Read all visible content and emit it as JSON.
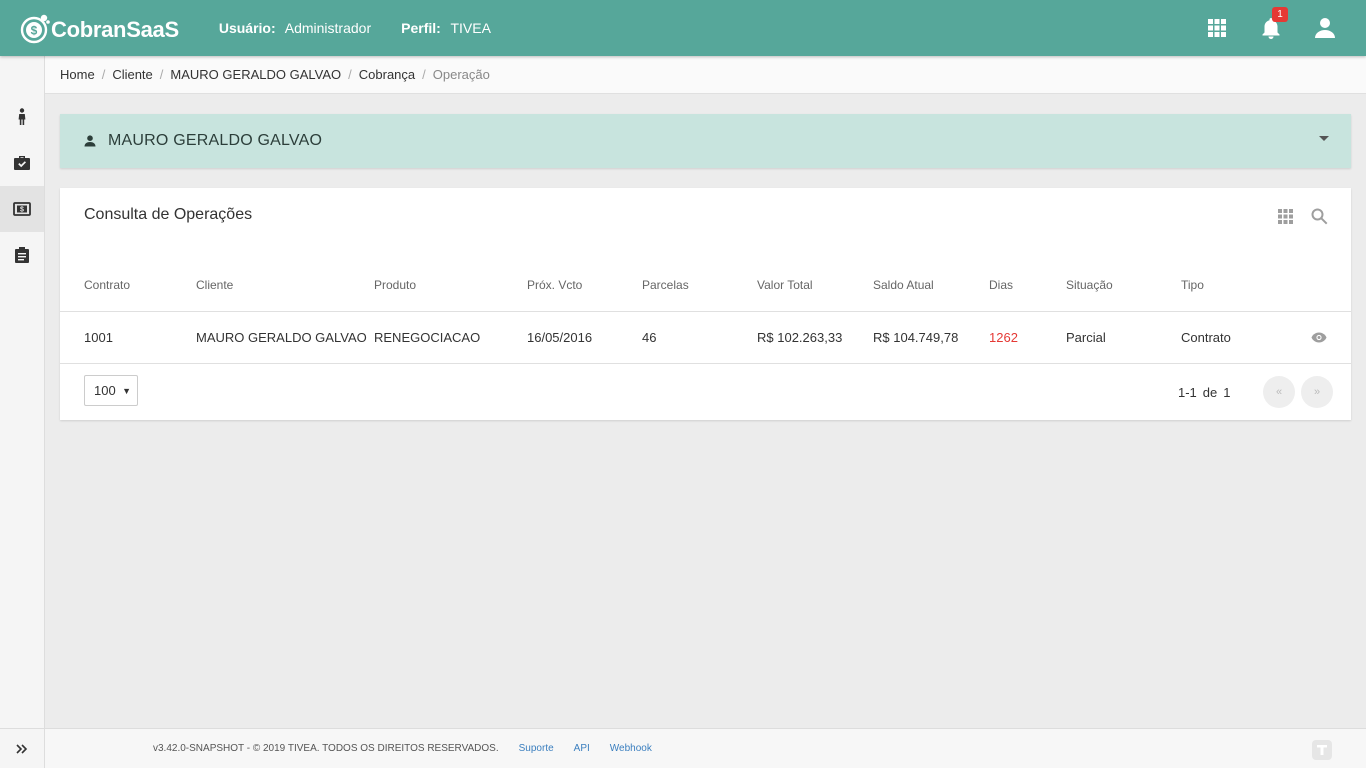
{
  "app": {
    "name": "CobranSaaS",
    "brand_color": "#56a79a"
  },
  "header": {
    "user_label": "Usuário:",
    "user_value": "Administrador",
    "profile_label": "Perfil:",
    "profile_value": "TIVEA",
    "notifications_count": "1",
    "icons": [
      "apps-grid-icon",
      "bell-icon",
      "account-icon"
    ]
  },
  "sidebar": {
    "items": [
      {
        "icon": "person-icon"
      },
      {
        "icon": "briefcase-check-icon"
      },
      {
        "icon": "money-icon",
        "active": true
      },
      {
        "icon": "clipboard-icon"
      }
    ],
    "expand_icon": "double-chevron-right-icon"
  },
  "breadcrumb": {
    "items": [
      "Home",
      "Cliente",
      "MAURO GERALDO GALVAO",
      "Cobrança"
    ],
    "current": "Operação"
  },
  "client": {
    "name": "MAURO GERALDO GALVAO"
  },
  "operations": {
    "title": "Consulta de Operações",
    "columns": [
      "Contrato",
      "Cliente",
      "Produto",
      "Próx. Vcto",
      "Parcelas",
      "Valor Total",
      "Saldo Atual",
      "Dias",
      "Situação",
      "Tipo"
    ],
    "rows": [
      {
        "contrato": "1001",
        "cliente": "MAURO GERALDO GALVAO",
        "produto": "RENEGOCIACAO",
        "prox_vcto": "16/05/2016",
        "parcelas": "46",
        "valor_total": "R$ 102.263,33",
        "saldo_atual": "R$ 104.749,78",
        "dias": "1262",
        "situacao": "Parcial",
        "tipo": "Contrato"
      }
    ],
    "page_size": "100",
    "range": "1-1",
    "of_label": "de",
    "total": "1",
    "prev_label": "«",
    "next_label": "»",
    "alert_color": "#e53935"
  },
  "footer": {
    "copyright": "v3.42.0-SNAPSHOT - © 2019 TIVEA. TODOS OS DIREITOS RESERVADOS.",
    "links": [
      "Suporte",
      "API",
      "Webhook"
    ]
  }
}
